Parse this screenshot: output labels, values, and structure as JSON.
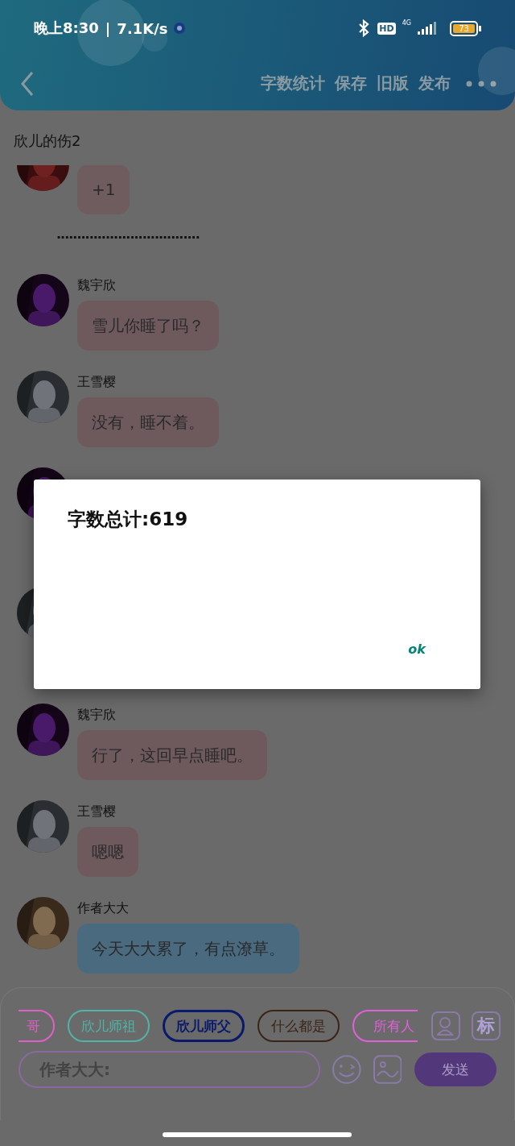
{
  "status_bar": {
    "time": "晚上8:30",
    "separator": "|",
    "speed": "7.1K/s",
    "hd": "HD",
    "network": "4G",
    "battery": "73"
  },
  "nav": {
    "actions": [
      "字数统计",
      "保存",
      "旧版",
      "发布"
    ]
  },
  "title": "欣儿的伤2",
  "messages": [
    {
      "kind": "message",
      "text": "+1",
      "color": "#6e5c5e"
    },
    {
      "kind": "separator",
      "text": "···································"
    },
    {
      "kind": "message",
      "name": "魏宇欣",
      "text": "雪儿你睡了吗？",
      "color": "#6e5a5c"
    },
    {
      "kind": "message",
      "name": "王雪樱",
      "text": "没有，睡不着。",
      "color": "#6e5a5c"
    },
    {
      "kind": "covered"
    },
    {
      "kind": "covered"
    },
    {
      "kind": "message",
      "name": "魏宇欣",
      "text": "行了，这回早点睡吧。",
      "color": "#6e5a5c"
    },
    {
      "kind": "message",
      "name": "王雪樱",
      "text": "嗯嗯",
      "color": "#6e5a5c"
    },
    {
      "kind": "message",
      "name": "作者大大",
      "text": "今天大大累了，有点潦草。",
      "color": "#4a6a80"
    }
  ],
  "chips": [
    {
      "label": "哥",
      "color": "#e060c8",
      "selected": false
    },
    {
      "label": "欣儿师祖",
      "color": "#50b4a6",
      "selected": false
    },
    {
      "label": "欣儿师父",
      "color": "#0a1a6a",
      "selected": true
    },
    {
      "label": "什么都是",
      "color": "#3a2418",
      "selected": false
    },
    {
      "label": "所有人",
      "color": "#e060d8",
      "selected": false
    }
  ],
  "mark_button": "标",
  "input": {
    "value": "作者大大:"
  },
  "send": "发送",
  "dialog": {
    "title": "字数总计:619",
    "button": "ok"
  }
}
